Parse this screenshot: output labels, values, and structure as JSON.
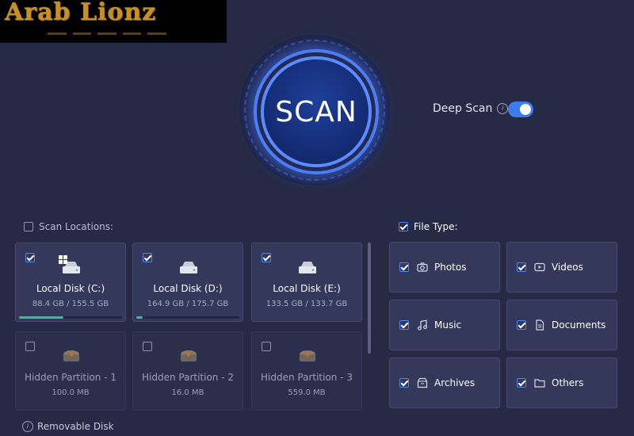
{
  "logo": {
    "text": "Arab Lionz"
  },
  "scan": {
    "label": "SCAN"
  },
  "deep_scan": {
    "label": "Deep Scan",
    "enabled": true
  },
  "scan_locations": {
    "header": "Scan Locations:",
    "checked": false,
    "disks": [
      {
        "name": "Local Disk (C:)",
        "size": "88.4 GB / 155.5 GB",
        "checked": true,
        "usage": 0.43,
        "has_windows_badge": true
      },
      {
        "name": "Local Disk (D:)",
        "size": "164.9 GB / 175.7 GB",
        "checked": true,
        "usage": 0.06,
        "has_windows_badge": false
      },
      {
        "name": "Local Disk (E:)",
        "size": "133.5 GB / 133.7 GB",
        "checked": true,
        "usage": 0.0,
        "has_windows_badge": false
      }
    ],
    "partitions": [
      {
        "name": "Hidden Partition - 1",
        "size": "100.0 MB",
        "checked": false
      },
      {
        "name": "Hidden Partition - 2",
        "size": "16.0 MB",
        "checked": false
      },
      {
        "name": "Hidden Partition - 3",
        "size": "559.0 MB",
        "checked": false
      }
    ]
  },
  "file_type": {
    "header": "File Type:",
    "checked": true,
    "types": [
      {
        "label": "Photos",
        "icon": "camera-icon",
        "checked": true
      },
      {
        "label": "Videos",
        "icon": "play-icon",
        "checked": true
      },
      {
        "label": "Music",
        "icon": "music-icon",
        "checked": true
      },
      {
        "label": "Documents",
        "icon": "document-icon",
        "checked": true
      },
      {
        "label": "Archives",
        "icon": "archive-icon",
        "checked": true
      },
      {
        "label": "Others",
        "icon": "folder-icon",
        "checked": true
      }
    ]
  },
  "footer": {
    "label": "Removable Disk"
  },
  "colors": {
    "accent": "#3b7cf2",
    "background": "#262a45",
    "card": "#34385a",
    "usage": "#2ec48a",
    "logo": "#c98f20"
  }
}
